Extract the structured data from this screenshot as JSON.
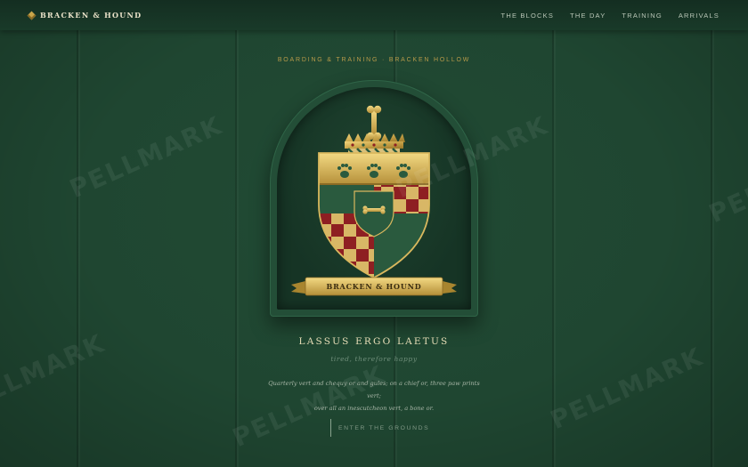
{
  "header": {
    "brand": "BRACKEN & HOUND",
    "nav": [
      "THE BLOCKS",
      "THE DAY",
      "TRAINING",
      "ARRIVALS"
    ]
  },
  "hero": {
    "kicker": "BOARDING & TRAINING · BRACKEN HOLLOW",
    "crest_banner": "BRACKEN & HOUND",
    "motto": "LASSUS ERGO LAETUS",
    "motto_translation": "tired, therefore happy",
    "blazon_line1": "Quarterly vert and chequy or and gules; on a chief or, three paw prints vert;",
    "blazon_line2": "over all an inescutcheon vert, a bone or.",
    "cta": "ENTER THE GROUNDS"
  },
  "watermark": "PELLMARK",
  "colors": {
    "background": "#1f4631",
    "gold": "#c9a54a",
    "gules": "#8e1f22",
    "vert": "#2a5a3e"
  }
}
